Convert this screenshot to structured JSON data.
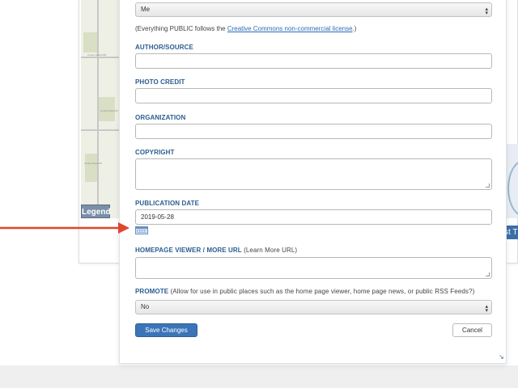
{
  "background": {
    "legend_label": "Legend",
    "right_tab_label": "st T",
    "map_labels": [
      "County Road 256",
      "County Road 26",
      "County Road 28"
    ]
  },
  "form": {
    "owner_select_value": "Me",
    "license_prefix": "(Everything PUBLIC follows the ",
    "license_link": "Creative Commons non-commercial license",
    "license_suffix": ".)",
    "author_label": "AUTHOR/SOURCE",
    "author_value": "",
    "photo_credit_label": "PHOTO CREDIT",
    "photo_credit_value": "",
    "organization_label": "ORGANIZATION",
    "organization_value": "",
    "copyright_label": "COPYRIGHT",
    "publication_date_label": "PUBLICATION DATE",
    "publication_date_value": "2019-05-28",
    "homepage_label": "HOMEPAGE VIEWER / MORE URL",
    "homepage_note": " (Learn More URL)",
    "promote_label": "PROMOTE",
    "promote_note": " (Allow for use in public places such as the home page viewer, home page news, or public RSS Feeds?)",
    "promote_value": "No",
    "save_label": "Save Changes",
    "cancel_label": "Cancel"
  },
  "icons": {
    "select_arrows": "updown-arrows-icon",
    "calendar": "calendar-icon",
    "resize": "resize-corner-icon",
    "annotation_arrow": "red-arrow-icon"
  },
  "colors": {
    "label_blue": "#2a5d8f",
    "primary_button": "#3a75b8",
    "annotation_arrow": "#e0452e"
  }
}
